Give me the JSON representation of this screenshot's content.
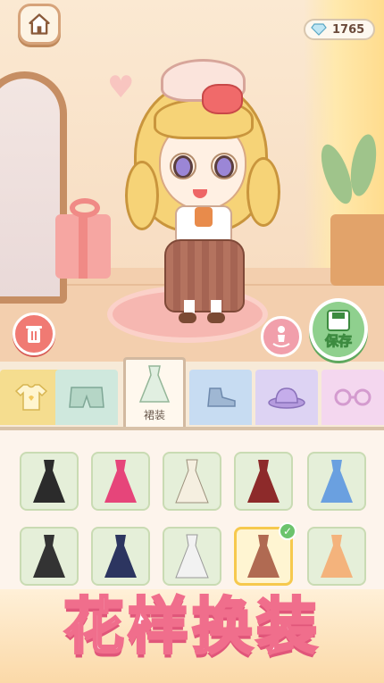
{
  "currency": {
    "gems": "1765",
    "icon": "gem-icon"
  },
  "actions": {
    "save_label": "保存"
  },
  "tabs": [
    {
      "id": "top",
      "icon": "shirt-icon",
      "color": "#f5dd8f"
    },
    {
      "id": "pants",
      "icon": "shorts-icon",
      "color": "#cfe8dd"
    },
    {
      "id": "dress",
      "icon": "dress-icon",
      "label": "裙装",
      "active": true
    },
    {
      "id": "shoes",
      "icon": "shoe-icon",
      "color": "#c7dcf2"
    },
    {
      "id": "hat",
      "icon": "hat-icon",
      "color": "#ddd3f3"
    },
    {
      "id": "glasses",
      "icon": "glasses-icon",
      "color": "#f4d7ef"
    }
  ],
  "items": [
    {
      "name": "black-gothic-dress",
      "color": "#2b2b2b"
    },
    {
      "name": "pink-black-dress",
      "color": "#e6457a"
    },
    {
      "name": "white-jacket-skirt",
      "color": "#f5efe0"
    },
    {
      "name": "red-black-coat",
      "color": "#8d2a2a"
    },
    {
      "name": "blue-dress",
      "color": "#6aa0e0"
    },
    {
      "name": "maid-dress",
      "color": "#333333"
    },
    {
      "name": "navy-star-dress",
      "color": "#2c3560"
    },
    {
      "name": "white-lab-coat",
      "color": "#f2f2f2"
    },
    {
      "name": "plaid-school-dress",
      "color": "#b06a52",
      "selected": true
    },
    {
      "name": "peach-dress",
      "color": "#f4b37c"
    }
  ],
  "banner": {
    "title": "花样换装"
  }
}
